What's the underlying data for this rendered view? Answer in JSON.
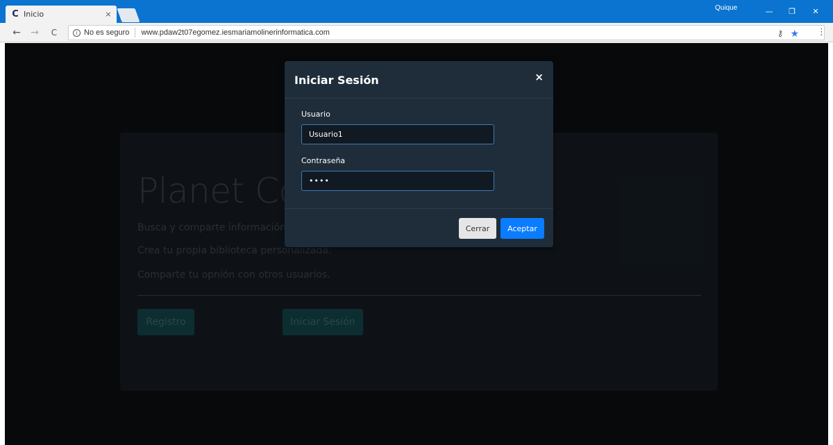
{
  "browser": {
    "tab_favicon": "C",
    "tab_title": "Inicio",
    "tab_close": "×",
    "profile_name": "Quique",
    "minimize": "—",
    "restore": "❐",
    "close": "✕",
    "back": "←",
    "forward": "→",
    "reload": "C",
    "security_label": "No es seguro",
    "url": "www.pdaw2t07egomez.iesmariamolinerinformatica.com"
  },
  "page": {
    "jumbotron": {
      "title": "Planet Co",
      "line1": "Busca y comparte información de",
      "line2": "Crea tu propia biblioteca personalizada.",
      "line3": "Comparte tu opnión con otros usuarios.",
      "btn_registro": "Registro",
      "btn_iniciar": "Iniciar Sesión"
    }
  },
  "modal": {
    "title": "Iniciar Sesión",
    "close_symbol": "×",
    "usuario_label": "Usuario",
    "usuario_value": "Usuario1",
    "password_label": "Contraseña",
    "password_value": "••••",
    "btn_cerrar": "Cerrar",
    "btn_aceptar": "Aceptar"
  },
  "colors": {
    "titlebar": "#0a74d0",
    "page_bg": "#0b0e11",
    "modal_bg": "#1f2d3a",
    "primary": "#0a7cff"
  }
}
